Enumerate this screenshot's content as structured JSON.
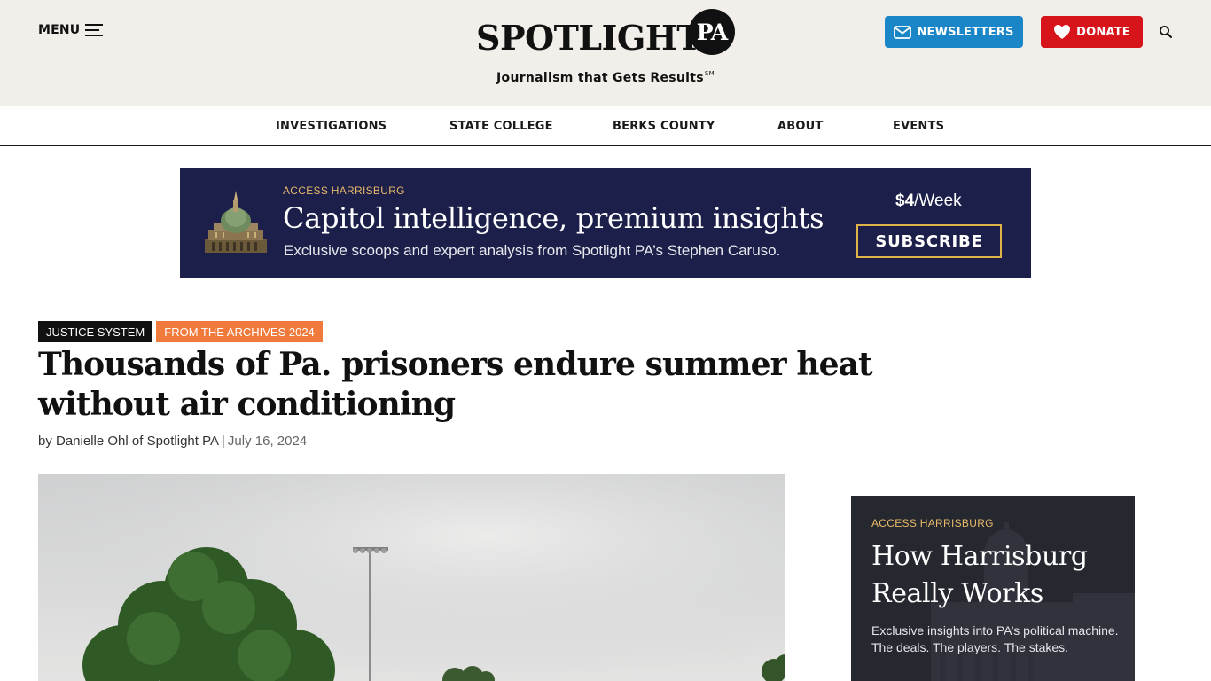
{
  "header": {
    "menu_label": "MENU",
    "logo_word": "SPOTLIGHT",
    "logo_badge": "PA",
    "tagline": "Journalism that Gets Results",
    "tagline_mark": "SM",
    "newsletters_label": "NEWSLETTERS",
    "donate_label": "DONATE"
  },
  "nav": {
    "items": [
      {
        "label": "INVESTIGATIONS"
      },
      {
        "label": "STATE COLLEGE"
      },
      {
        "label": "BERKS COUNTY"
      },
      {
        "label": "ABOUT"
      },
      {
        "label": "EVENTS"
      }
    ]
  },
  "banner_ad": {
    "kicker": "ACCESS HARRISBURG",
    "title": "Capitol intelligence, premium insights",
    "subtitle": "Exclusive scoops and expert analysis from Spotlight PA’s Stephen Caruso.",
    "price_amount": "$4",
    "price_period": "/Week",
    "cta": "SUBSCRIBE"
  },
  "article": {
    "tags": [
      {
        "label": "JUSTICE SYSTEM"
      },
      {
        "label": "FROM THE ARCHIVES 2024"
      }
    ],
    "headline": "Thousands of Pa. prisoners endure summer heat without air conditioning",
    "byline_author": "by Danielle Ohl of Spotlight PA",
    "byline_sep": "|",
    "byline_date": "July 16, 2024"
  },
  "side_ad": {
    "kicker": "ACCESS HARRISBURG",
    "title": "How Harrisburg Really Works",
    "subtitle": "Exclusive insights into PA’s political machine. The deals. The players. The stakes."
  },
  "colors": {
    "masthead_bg": "#f2efea",
    "newsletter_blue": "#1a86c8",
    "donate_red": "#d7141a",
    "banner_navy": "#1c1f4a",
    "tag_orange": "#f07a3c",
    "ad_gold": "#e8b96a"
  },
  "icons": {
    "menu": "hamburger-icon",
    "newsletter": "envelope-icon",
    "donate": "heart-icon",
    "search": "search-icon"
  }
}
